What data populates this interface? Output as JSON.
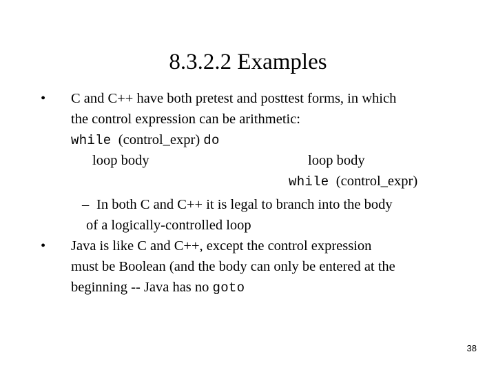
{
  "slide": {
    "title": "8.3.2.2 Examples",
    "page_number": "38",
    "background_color": "#ffffff",
    "text_color": "#000000"
  },
  "bullets": [
    {
      "marker": "•",
      "lines": [
        "C and C++ have both pretest and posttest forms, in which",
        "the control expression can be arithmetic:"
      ]
    }
  ],
  "code_block": {
    "pretest": {
      "header_keyword": "while",
      "header_condition": "(control_expr)",
      "header_trailer": "do",
      "body": "loop body"
    },
    "posttest": {
      "body": "loop body",
      "footer_keyword": "while",
      "footer_condition": "(control_expr)"
    }
  },
  "sub_bullet": {
    "marker": "–",
    "line1": "In both C and C++ it is legal to branch into the body",
    "line2": "of a logically-controlled loop"
  },
  "bullet2": {
    "marker": "•",
    "line1": "Java is like C and C++, except the control expression",
    "line2": "must be Boolean (and the body can only be entered at the",
    "line3_prefix": "beginning -- Java has no ",
    "line3_code": "goto"
  }
}
